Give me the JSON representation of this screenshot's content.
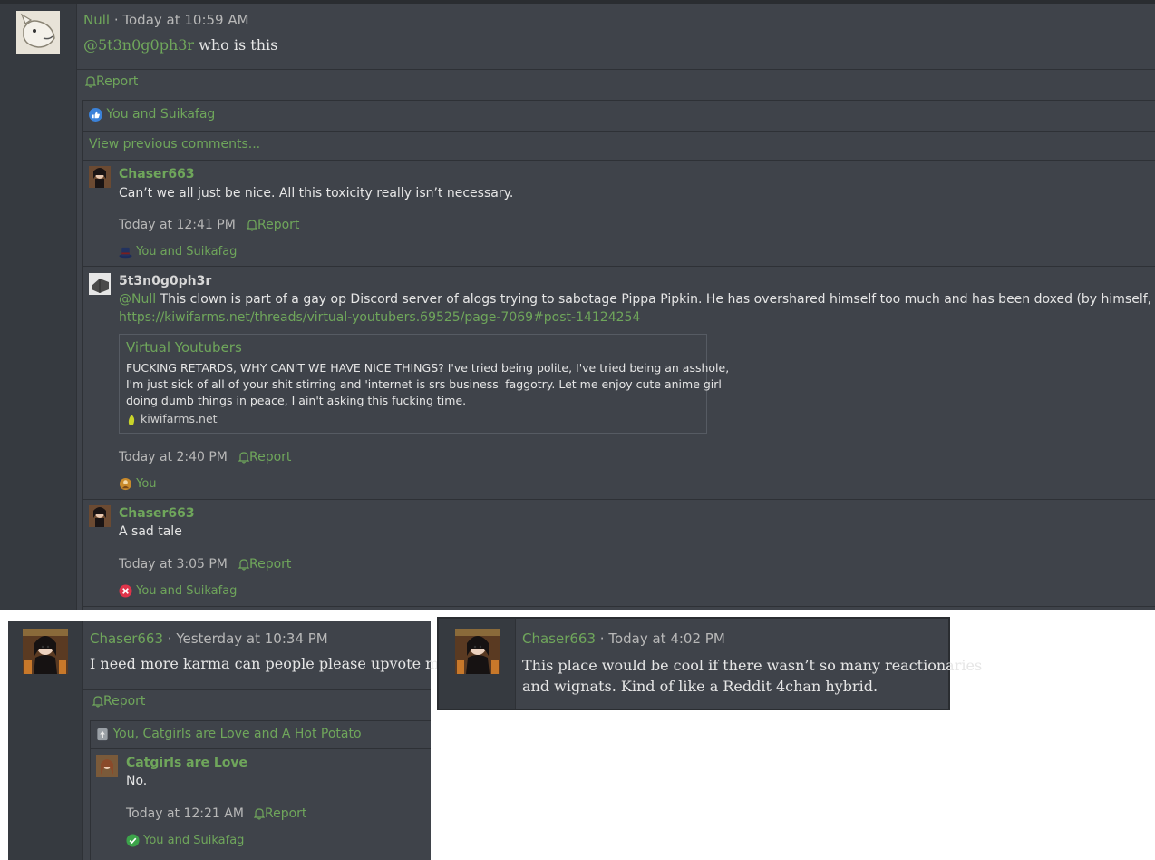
{
  "top": {
    "post": {
      "author": "Null",
      "separator": " · ",
      "time": "Today at 10:59 AM",
      "mention": "@5t3n0g0ph3r",
      "text": " who is this",
      "report_label": "Report",
      "reactions_label": "You and Suikafag",
      "view_previous": "View previous comments..."
    },
    "comments": [
      {
        "author": "Chaser663",
        "text": "Can’t we all just be nice. All this toxicity really isn’t necessary.",
        "time": "Today at 12:41 PM",
        "report_label": "Report",
        "reactions_label": "You and Suikafag",
        "reaction_icon": "top-hat-icon"
      },
      {
        "author": "5t3n0g0ph3r",
        "mention": "@Null",
        "text": " This clown is part of a gay op Discord server of alogs trying to sabotage Pippa Pipkin. He has overshared himself too much and has been doxed (by himself, no less):",
        "link": "https://kiwifarms.net/threads/virtual-youtubers.69525/page-7069#post-14124254",
        "embed": {
          "title": "Virtual Youtubers",
          "body_lines": [
            "FUCKING RETARDS, WHY CAN'T WE HAVE NICE THINGS? I've tried being polite, I've tried being an asshole,",
            "I'm just sick of all of your shit stirring and 'internet is srs business' faggotry. Let me enjoy cute anime girl",
            "doing dumb things in peace, I ain't asking this fucking time."
          ],
          "site": "kiwifarms.net"
        },
        "time": "Today at 2:40 PM",
        "report_label": "Report",
        "reactions_label": "You",
        "reaction_icon": "winner-icon"
      },
      {
        "author": "Chaser663",
        "text": "A sad tale",
        "time": "Today at 3:05 PM",
        "report_label": "Report",
        "reactions_label": "You and Suikafag",
        "reaction_icon": "dislike-x-icon"
      }
    ]
  },
  "bottom_left": {
    "author": "Chaser663",
    "separator": " · ",
    "time": "Yesterday at 10:34 PM",
    "text": "I need more karma can people please upvote me",
    "report_label": "Report",
    "reactions_label": "You, Catgirls are Love and A Hot Potato",
    "comment": {
      "author": "Catgirls are Love",
      "text": "No.",
      "time": "Today at 12:21 AM",
      "report_label": "Report",
      "reactions_label": "You and Suikafag",
      "reaction_icon": "check-icon"
    }
  },
  "bottom_right": {
    "author": "Chaser663",
    "separator": " · ",
    "time": "Today at 4:02 PM",
    "text_line1": "This place would be cool if there wasn’t so many reactionaries",
    "text_line2": "and wignats. Kind of like a Reddit 4chan hybrid."
  },
  "colors": {
    "panel": "#3f434a",
    "gutter": "#363a40",
    "accent_green": "#6fa65b",
    "text": "#e6e6e6"
  }
}
